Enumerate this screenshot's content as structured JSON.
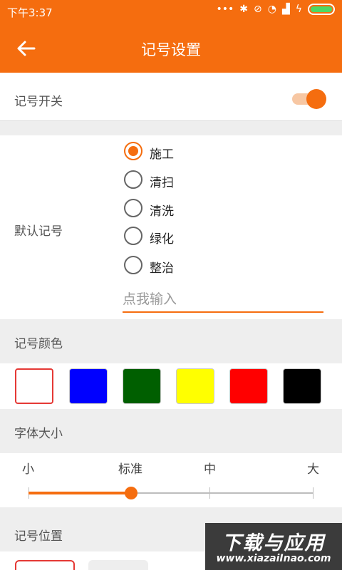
{
  "status_bar": {
    "time": "下午3:37",
    "icons": [
      "more-dots-icon",
      "bluetooth-icon",
      "mute-icon",
      "wifi-icon",
      "signal-icon",
      "charging-icon",
      "battery-icon"
    ]
  },
  "toolbar": {
    "title": "记号设置",
    "back_icon": "arrow-left-icon"
  },
  "switch_row": {
    "label": "记号开关",
    "enabled": true
  },
  "default_mark": {
    "label": "默认记号",
    "options": [
      {
        "label": "施工",
        "checked": true
      },
      {
        "label": "清扫",
        "checked": false
      },
      {
        "label": "清洗",
        "checked": false
      },
      {
        "label": "绿化",
        "checked": false
      },
      {
        "label": "整治",
        "checked": false
      }
    ],
    "input_placeholder": "点我输入"
  },
  "color_section": {
    "label": "记号颜色",
    "colors": [
      "#ffffff",
      "#0000ff",
      "#005f00",
      "#ffff00",
      "#ff0000",
      "#000000"
    ],
    "selected_index": 0
  },
  "font_section": {
    "label": "字体大小",
    "sizes": [
      "小",
      "标准",
      "中",
      "大"
    ],
    "selected_index": 1
  },
  "position_section": {
    "label": "记号位置"
  },
  "watermark": {
    "main": "下载与应用",
    "url": "www.xiazaiInao.com"
  },
  "colors": {
    "accent": "#f56d0f",
    "section_bg": "#eeeeee"
  }
}
